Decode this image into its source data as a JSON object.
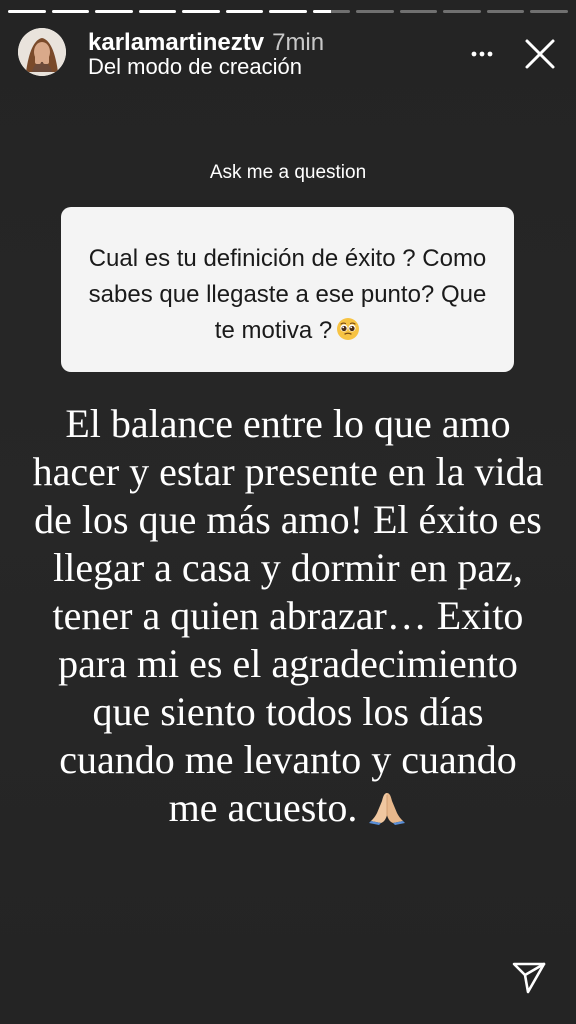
{
  "story": {
    "progress_segments": [
      1,
      1,
      1,
      1,
      1,
      1,
      1,
      0.5,
      0,
      0,
      0,
      0,
      0
    ],
    "username": "karlamartineztv",
    "time": "7min",
    "subtitle": "Del modo de creación",
    "avatar_icon": "profile-photo",
    "more_icon": "ellipsis-icon",
    "close_icon": "close-icon",
    "send_icon": "send-icon"
  },
  "question_sticker": {
    "label": "Ask me a question",
    "question": "Cual es tu definición de éxito ? Como sabes que llegaste a ese punto? Que te motiva ?",
    "emoji": "pleading-face"
  },
  "answer": {
    "text": "El balance entre lo que amo hacer y estar presente en la vida de los que más amo! El éxito es llegar a casa y dormir en paz, tener a quien abrazar… Exito para mi es el agradecimiento que siento todos los días cuando me levanto y cuando me acuesto.",
    "emoji": "folded-hands"
  },
  "colors": {
    "background": "#262626",
    "card": "#f4f4f4",
    "text": "#ffffff",
    "card_text": "#1a1a1a"
  }
}
